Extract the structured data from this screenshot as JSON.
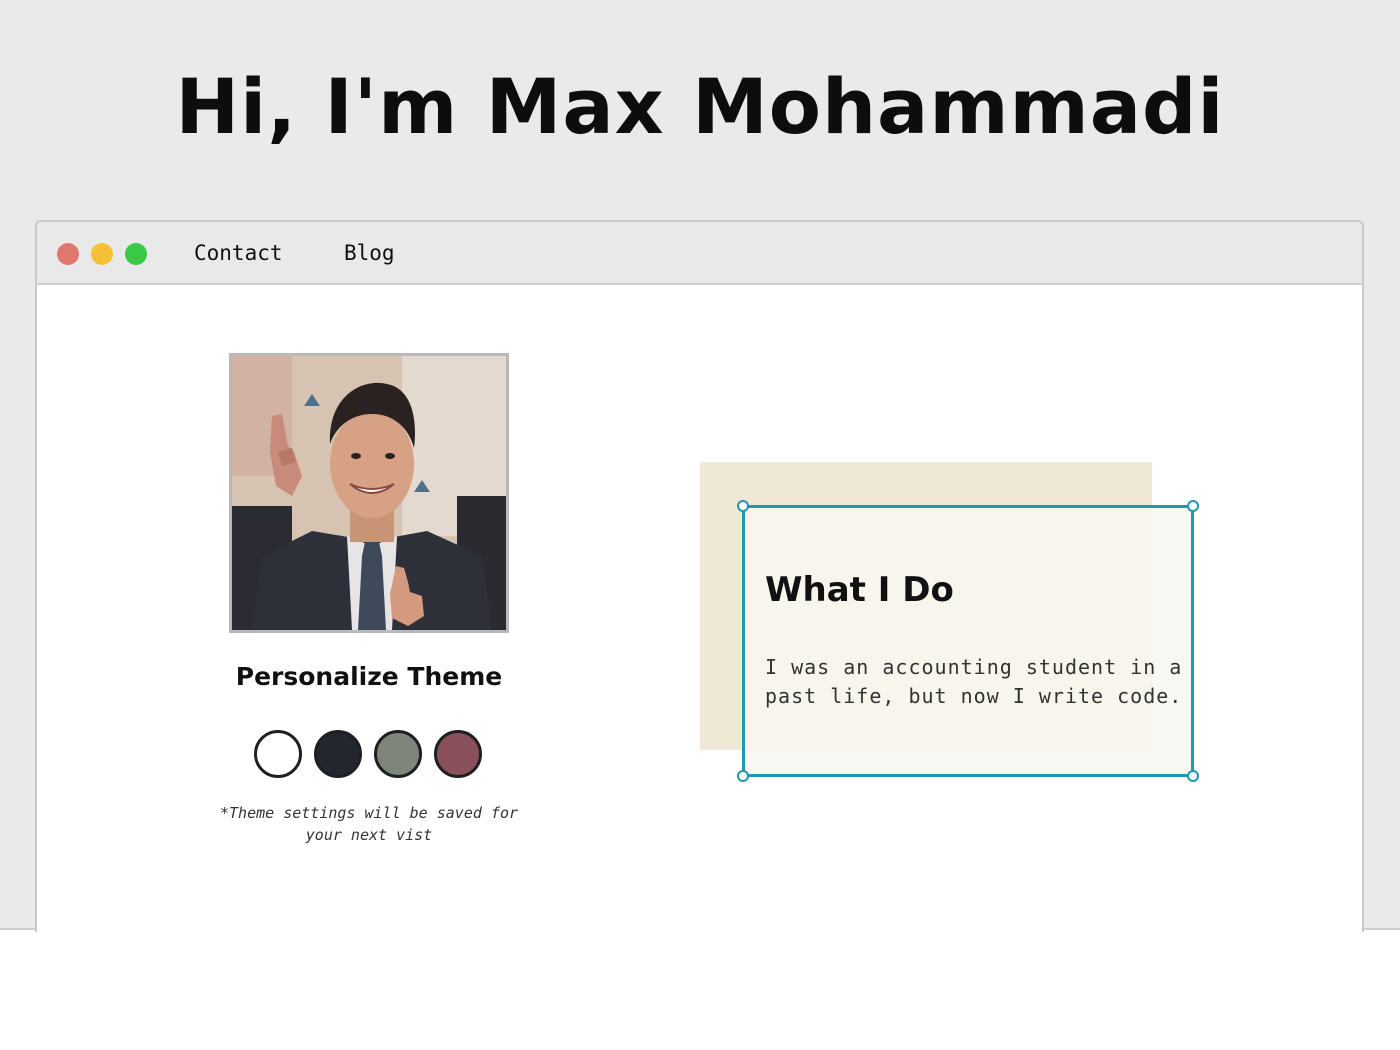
{
  "hero": {
    "title": "Hi, I'm Max Mohammadi"
  },
  "window": {
    "nav": {
      "contact": "Contact",
      "blog": "Blog"
    }
  },
  "profile": {
    "photo_alt": "Photo of Max Mohammadi"
  },
  "theme": {
    "heading": "Personalize Theme",
    "swatches": [
      {
        "name": "light",
        "color": "#ffffff"
      },
      {
        "name": "dark",
        "color": "#23262f"
      },
      {
        "name": "sage",
        "color": "#7e857a"
      },
      {
        "name": "rose",
        "color": "#8a515a"
      }
    ],
    "note": "*Theme settings will be saved for your next vist"
  },
  "about": {
    "title": "What I Do",
    "text": "I was an accounting student in a past life, but now I write code."
  },
  "colors": {
    "page_bg": "#eaeaea",
    "accent": "#1e97b1",
    "card_backdrop": "#efe8d5",
    "dot_red": "#e0776f",
    "dot_yellow": "#f6c037",
    "dot_green": "#39c848"
  }
}
